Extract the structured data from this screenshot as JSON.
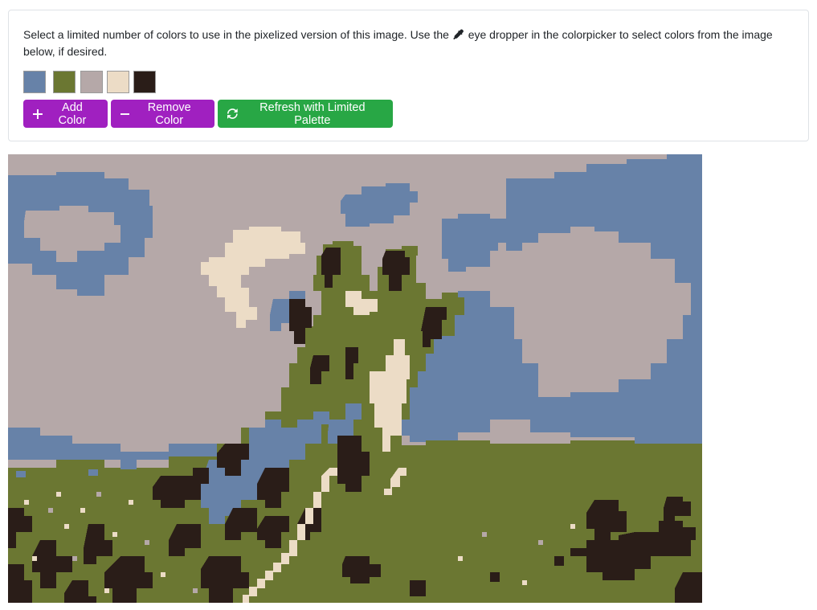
{
  "panel": {
    "instructions_part1": "Select a limited number of colors to use in the pixelized version of this image. Use the",
    "instructions_part2": "eye dropper in the colorpicker to select colors from the image below, if desired."
  },
  "palette": [
    {
      "name": "slate-blue",
      "color": "#6782a8"
    },
    {
      "name": "olive-green",
      "color": "#6b7732"
    },
    {
      "name": "mauve-gray",
      "color": "#b5a8a8"
    },
    {
      "name": "cream",
      "color": "#ecdcc6"
    },
    {
      "name": "dark-brown",
      "color": "#2a1d18"
    }
  ],
  "buttons": {
    "add_color": "Add Color",
    "remove_color": "Remove Color",
    "refresh": "Refresh with Limited Palette"
  },
  "colors": {
    "button_purple": "#a020c0",
    "button_green": "#28a745",
    "border": "#dee2e6"
  },
  "image": {
    "description_icon": "pixelized-giraffe-image"
  }
}
